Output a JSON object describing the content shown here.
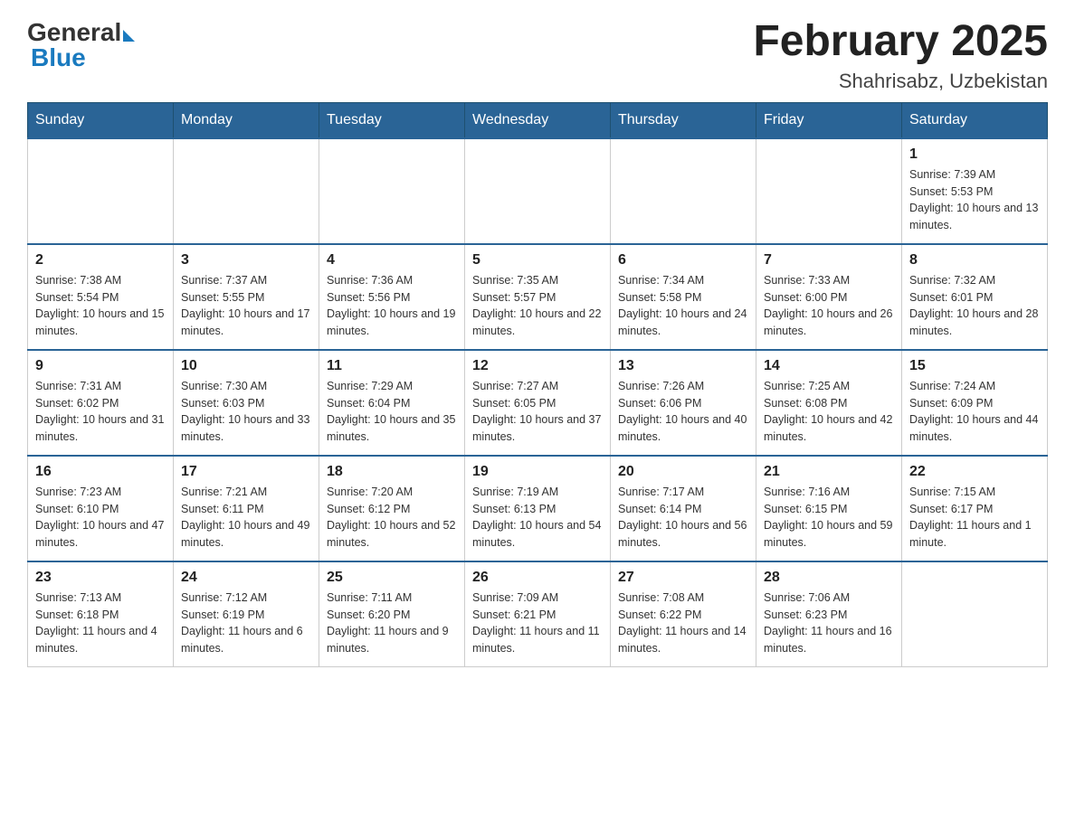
{
  "header": {
    "logo_general": "General",
    "logo_blue": "Blue",
    "title": "February 2025",
    "subtitle": "Shahrisabz, Uzbekistan"
  },
  "weekdays": [
    "Sunday",
    "Monday",
    "Tuesday",
    "Wednesday",
    "Thursday",
    "Friday",
    "Saturday"
  ],
  "weeks": [
    [
      {
        "day": "",
        "info": ""
      },
      {
        "day": "",
        "info": ""
      },
      {
        "day": "",
        "info": ""
      },
      {
        "day": "",
        "info": ""
      },
      {
        "day": "",
        "info": ""
      },
      {
        "day": "",
        "info": ""
      },
      {
        "day": "1",
        "info": "Sunrise: 7:39 AM\nSunset: 5:53 PM\nDaylight: 10 hours and 13 minutes."
      }
    ],
    [
      {
        "day": "2",
        "info": "Sunrise: 7:38 AM\nSunset: 5:54 PM\nDaylight: 10 hours and 15 minutes."
      },
      {
        "day": "3",
        "info": "Sunrise: 7:37 AM\nSunset: 5:55 PM\nDaylight: 10 hours and 17 minutes."
      },
      {
        "day": "4",
        "info": "Sunrise: 7:36 AM\nSunset: 5:56 PM\nDaylight: 10 hours and 19 minutes."
      },
      {
        "day": "5",
        "info": "Sunrise: 7:35 AM\nSunset: 5:57 PM\nDaylight: 10 hours and 22 minutes."
      },
      {
        "day": "6",
        "info": "Sunrise: 7:34 AM\nSunset: 5:58 PM\nDaylight: 10 hours and 24 minutes."
      },
      {
        "day": "7",
        "info": "Sunrise: 7:33 AM\nSunset: 6:00 PM\nDaylight: 10 hours and 26 minutes."
      },
      {
        "day": "8",
        "info": "Sunrise: 7:32 AM\nSunset: 6:01 PM\nDaylight: 10 hours and 28 minutes."
      }
    ],
    [
      {
        "day": "9",
        "info": "Sunrise: 7:31 AM\nSunset: 6:02 PM\nDaylight: 10 hours and 31 minutes."
      },
      {
        "day": "10",
        "info": "Sunrise: 7:30 AM\nSunset: 6:03 PM\nDaylight: 10 hours and 33 minutes."
      },
      {
        "day": "11",
        "info": "Sunrise: 7:29 AM\nSunset: 6:04 PM\nDaylight: 10 hours and 35 minutes."
      },
      {
        "day": "12",
        "info": "Sunrise: 7:27 AM\nSunset: 6:05 PM\nDaylight: 10 hours and 37 minutes."
      },
      {
        "day": "13",
        "info": "Sunrise: 7:26 AM\nSunset: 6:06 PM\nDaylight: 10 hours and 40 minutes."
      },
      {
        "day": "14",
        "info": "Sunrise: 7:25 AM\nSunset: 6:08 PM\nDaylight: 10 hours and 42 minutes."
      },
      {
        "day": "15",
        "info": "Sunrise: 7:24 AM\nSunset: 6:09 PM\nDaylight: 10 hours and 44 minutes."
      }
    ],
    [
      {
        "day": "16",
        "info": "Sunrise: 7:23 AM\nSunset: 6:10 PM\nDaylight: 10 hours and 47 minutes."
      },
      {
        "day": "17",
        "info": "Sunrise: 7:21 AM\nSunset: 6:11 PM\nDaylight: 10 hours and 49 minutes."
      },
      {
        "day": "18",
        "info": "Sunrise: 7:20 AM\nSunset: 6:12 PM\nDaylight: 10 hours and 52 minutes."
      },
      {
        "day": "19",
        "info": "Sunrise: 7:19 AM\nSunset: 6:13 PM\nDaylight: 10 hours and 54 minutes."
      },
      {
        "day": "20",
        "info": "Sunrise: 7:17 AM\nSunset: 6:14 PM\nDaylight: 10 hours and 56 minutes."
      },
      {
        "day": "21",
        "info": "Sunrise: 7:16 AM\nSunset: 6:15 PM\nDaylight: 10 hours and 59 minutes."
      },
      {
        "day": "22",
        "info": "Sunrise: 7:15 AM\nSunset: 6:17 PM\nDaylight: 11 hours and 1 minute."
      }
    ],
    [
      {
        "day": "23",
        "info": "Sunrise: 7:13 AM\nSunset: 6:18 PM\nDaylight: 11 hours and 4 minutes."
      },
      {
        "day": "24",
        "info": "Sunrise: 7:12 AM\nSunset: 6:19 PM\nDaylight: 11 hours and 6 minutes."
      },
      {
        "day": "25",
        "info": "Sunrise: 7:11 AM\nSunset: 6:20 PM\nDaylight: 11 hours and 9 minutes."
      },
      {
        "day": "26",
        "info": "Sunrise: 7:09 AM\nSunset: 6:21 PM\nDaylight: 11 hours and 11 minutes."
      },
      {
        "day": "27",
        "info": "Sunrise: 7:08 AM\nSunset: 6:22 PM\nDaylight: 11 hours and 14 minutes."
      },
      {
        "day": "28",
        "info": "Sunrise: 7:06 AM\nSunset: 6:23 PM\nDaylight: 11 hours and 16 minutes."
      },
      {
        "day": "",
        "info": ""
      }
    ]
  ]
}
